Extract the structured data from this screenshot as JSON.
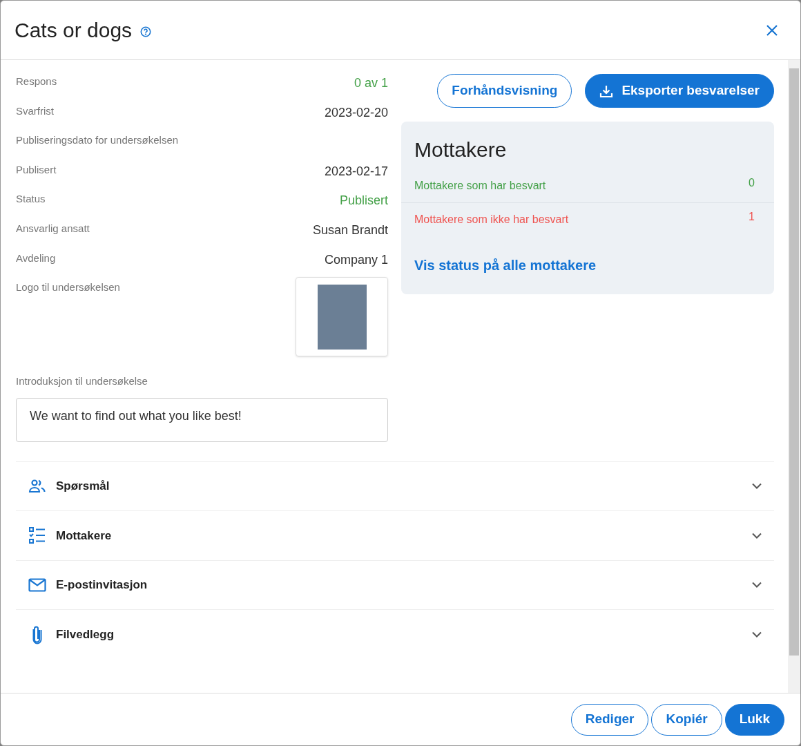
{
  "dialog": {
    "title": "Cats or dogs"
  },
  "fields": [
    {
      "label": "Respons",
      "value": "0 av 1",
      "color": "#43a047"
    },
    {
      "label": "Svarfrist",
      "value": "2023-02-20",
      "color": "#333333"
    },
    {
      "label": "Publiseringsdato for undersøkelsen"
    },
    {
      "label": "Publisert",
      "value": "2023-02-17",
      "color": "#333333"
    },
    {
      "label": "Status",
      "value": "Publisert",
      "color": "#43a047"
    },
    {
      "label": "Ansvarlig ansatt",
      "value": "Susan Brandt",
      "color": "#333333"
    },
    {
      "label": "Avdeling",
      "value": "Company 1",
      "color": "#333333"
    }
  ],
  "logo": {
    "label": "Logo til undersøkelsen"
  },
  "introduction": {
    "label": "Introduksjon til undersøkelse",
    "value": "We want to find out what you like best!"
  },
  "actions": [
    {
      "label": "Forhåndsvisning",
      "kind": "outline"
    },
    {
      "label": "Eksporter besvarelser",
      "kind": "filled"
    }
  ],
  "recipients": {
    "title": "Mottakere",
    "rows": [
      {
        "label": "Mottakere som har besvart",
        "count": "0",
        "color": "#43a047"
      },
      {
        "label": "Mottakere som ikke har besvart",
        "count": "1",
        "color": "#ef5350"
      }
    ],
    "link": "Vis status på alle mottakere"
  },
  "sections": [
    {
      "label": "Spørsmål",
      "kind": "people",
      "expanded": false
    },
    {
      "label": "Mottakere",
      "kind": "checklist",
      "expanded": false
    },
    {
      "label": "E-postinvitasjon",
      "kind": "mail",
      "expanded": false
    },
    {
      "label": "Filvedlegg",
      "kind": "attachment",
      "expanded": false
    }
  ],
  "footer_buttons": [
    {
      "label": "Rediger",
      "kind": "outline"
    },
    {
      "label": "Kopiér",
      "kind": "outline"
    },
    {
      "label": "Lukk",
      "kind": "filled"
    }
  ]
}
